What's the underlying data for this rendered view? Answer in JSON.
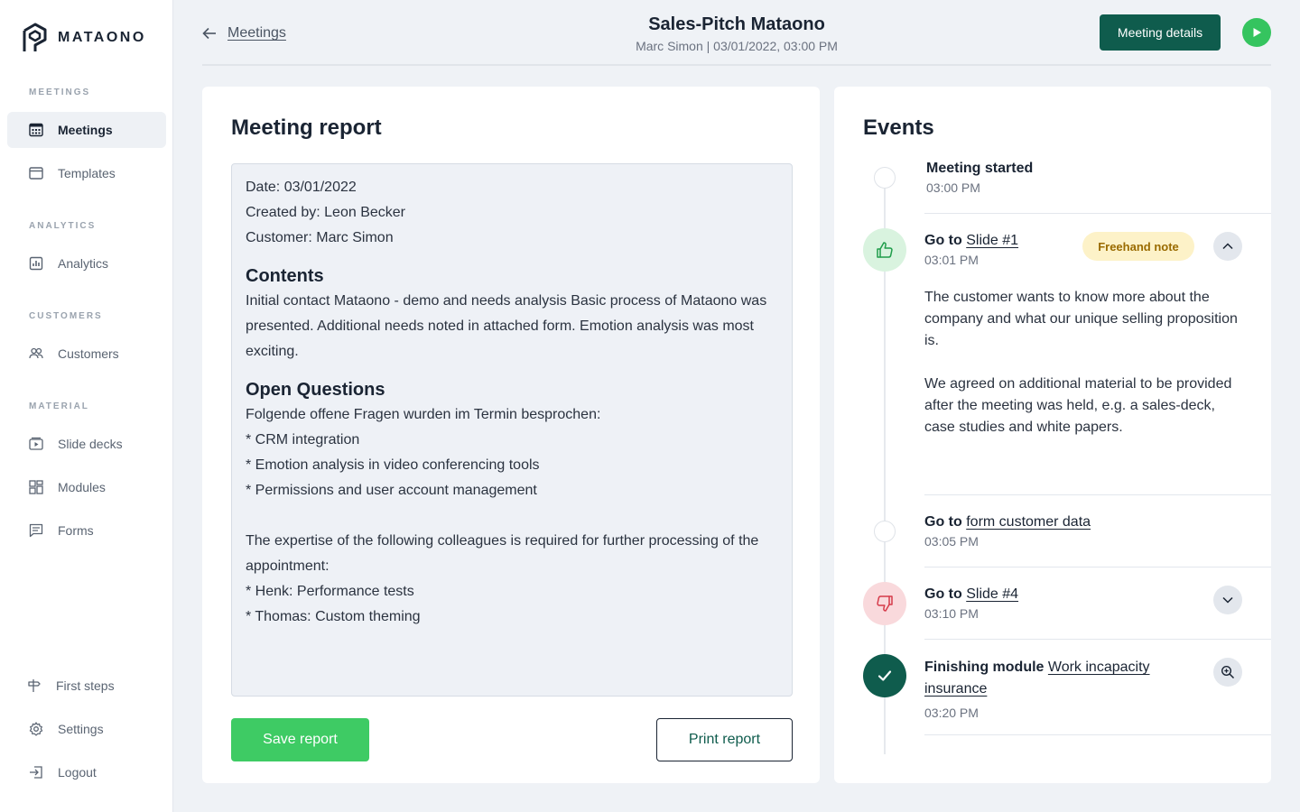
{
  "brand": {
    "name": "MATAONO"
  },
  "sidebar": {
    "sections": {
      "meetings": "MEETINGS",
      "analytics": "ANALYTICS",
      "customers": "CUSTOMERS",
      "material": "MATERIAL"
    },
    "items": {
      "meetings": "Meetings",
      "templates": "Templates",
      "analytics": "Analytics",
      "customers": "Customers",
      "slide_decks": "Slide decks",
      "modules": "Modules",
      "forms": "Forms",
      "first_steps": "First steps",
      "settings": "Settings",
      "logout": "Logout"
    },
    "active": "meetings"
  },
  "header": {
    "back_label": "Meetings",
    "title": "Sales-Pitch Mataono",
    "subtitle": "Marc Simon | 03/01/2022, 03:00 PM",
    "details_button": "Meeting details"
  },
  "report": {
    "title": "Meeting report",
    "date_line": "Date: 03/01/2022",
    "created_line": "Created by: Leon Becker",
    "customer_line": "Customer: Marc Simon",
    "contents_heading": "Contents",
    "contents_text": "Initial contact Mataono - demo and needs analysis Basic process of Mataono was presented. Additional needs noted in attached form. Emotion analysis was most exciting.",
    "questions_heading": "Open Questions",
    "questions_intro": "Folgende offene Fragen wurden im Termin besprochen:",
    "questions": [
      "* CRM integration",
      "* Emotion analysis in video conferencing tools",
      "* Permissions and user account management"
    ],
    "expertise_text": "The expertise of the following colleagues is required for further processing of the appointment:",
    "colleagues": [
      "* Henk: Performance tests",
      "* Thomas: Custom theming"
    ],
    "save_button": "Save report",
    "print_button": "Print report"
  },
  "events": {
    "title": "Events",
    "items": [
      {
        "label": "Meeting started",
        "link": "",
        "time": "03:00 PM"
      },
      {
        "label": "Go to",
        "link": "Slide #1",
        "time": "03:01 PM",
        "badge": "Freehand note",
        "note_1": "The customer wants to know more about the company and what our unique selling proposition is.",
        "note_2": "We agreed on additional material to be provided after the meeting was held, e.g. a sales-deck, case studies and white papers."
      },
      {
        "label": "Go to",
        "link": "form customer data",
        "time": "03:05 PM"
      },
      {
        "label": "Go to",
        "link": "Slide #4",
        "time": "03:10 PM"
      },
      {
        "label": "Finishing module",
        "link": "Work incapacity insurance",
        "time": "03:20 PM"
      }
    ]
  },
  "colors": {
    "primary_dark": "#0f5c4d",
    "success": "#3ecb64",
    "play": "#35c45f",
    "badge_bg": "#fdf2c8",
    "positive_bg": "#d9f3df",
    "negative_bg": "#f9d9dc"
  }
}
